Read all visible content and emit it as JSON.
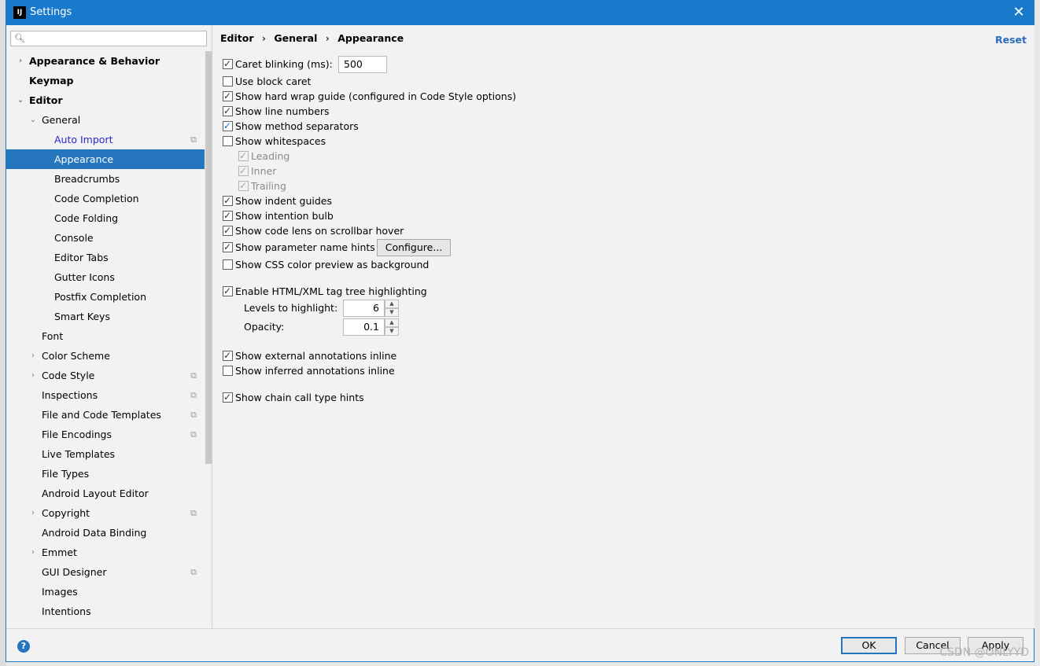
{
  "window": {
    "title": "Settings",
    "app_icon_text": "IJ",
    "close_glyph": "✕"
  },
  "search": {
    "value": "",
    "placeholder": ""
  },
  "sidebar": {
    "items": [
      {
        "label": "Appearance & Behavior",
        "bold": true,
        "arrow": "›",
        "level": 0,
        "copy": false
      },
      {
        "label": "Keymap",
        "bold": true,
        "arrow": "",
        "level": 0,
        "copy": false
      },
      {
        "label": "Editor",
        "bold": true,
        "arrow": "⌄",
        "level": 0,
        "copy": false
      },
      {
        "label": "General",
        "bold": false,
        "arrow": "⌄",
        "level": 1,
        "copy": false
      },
      {
        "label": "Auto Import",
        "bold": false,
        "arrow": "",
        "level": 2,
        "copy": true,
        "link": true
      },
      {
        "label": "Appearance",
        "bold": false,
        "arrow": "",
        "level": 2,
        "copy": false,
        "selected": true
      },
      {
        "label": "Breadcrumbs",
        "bold": false,
        "arrow": "",
        "level": 2,
        "copy": false
      },
      {
        "label": "Code Completion",
        "bold": false,
        "arrow": "",
        "level": 2,
        "copy": false
      },
      {
        "label": "Code Folding",
        "bold": false,
        "arrow": "",
        "level": 2,
        "copy": false
      },
      {
        "label": "Console",
        "bold": false,
        "arrow": "",
        "level": 2,
        "copy": false
      },
      {
        "label": "Editor Tabs",
        "bold": false,
        "arrow": "",
        "level": 2,
        "copy": false
      },
      {
        "label": "Gutter Icons",
        "bold": false,
        "arrow": "",
        "level": 2,
        "copy": false
      },
      {
        "label": "Postfix Completion",
        "bold": false,
        "arrow": "",
        "level": 2,
        "copy": false
      },
      {
        "label": "Smart Keys",
        "bold": false,
        "arrow": "",
        "level": 2,
        "copy": false
      },
      {
        "label": "Font",
        "bold": false,
        "arrow": "",
        "level": 1,
        "copy": false
      },
      {
        "label": "Color Scheme",
        "bold": false,
        "arrow": "›",
        "level": 1,
        "copy": false
      },
      {
        "label": "Code Style",
        "bold": false,
        "arrow": "›",
        "level": 1,
        "copy": true
      },
      {
        "label": "Inspections",
        "bold": false,
        "arrow": "",
        "level": 1,
        "copy": true
      },
      {
        "label": "File and Code Templates",
        "bold": false,
        "arrow": "",
        "level": 1,
        "copy": true
      },
      {
        "label": "File Encodings",
        "bold": false,
        "arrow": "",
        "level": 1,
        "copy": true
      },
      {
        "label": "Live Templates",
        "bold": false,
        "arrow": "",
        "level": 1,
        "copy": false
      },
      {
        "label": "File Types",
        "bold": false,
        "arrow": "",
        "level": 1,
        "copy": false
      },
      {
        "label": "Android Layout Editor",
        "bold": false,
        "arrow": "",
        "level": 1,
        "copy": false
      },
      {
        "label": "Copyright",
        "bold": false,
        "arrow": "›",
        "level": 1,
        "copy": true
      },
      {
        "label": "Android Data Binding",
        "bold": false,
        "arrow": "",
        "level": 1,
        "copy": false
      },
      {
        "label": "Emmet",
        "bold": false,
        "arrow": "›",
        "level": 1,
        "copy": false
      },
      {
        "label": "GUI Designer",
        "bold": false,
        "arrow": "",
        "level": 1,
        "copy": true
      },
      {
        "label": "Images",
        "bold": false,
        "arrow": "",
        "level": 1,
        "copy": false
      },
      {
        "label": "Intentions",
        "bold": false,
        "arrow": "",
        "level": 1,
        "copy": false
      }
    ]
  },
  "breadcrumb": {
    "items": [
      "Editor",
      "General",
      "Appearance"
    ],
    "separator": "›"
  },
  "reset_label": "Reset",
  "options": {
    "caret_blinking": {
      "label": "Caret blinking (ms):",
      "checked": true,
      "value": "500"
    },
    "block_caret": {
      "label": "Use block caret",
      "checked": false
    },
    "hard_wrap": {
      "label": "Show hard wrap guide (configured in Code Style options)",
      "checked": true
    },
    "line_numbers": {
      "label": "Show line numbers",
      "checked": true
    },
    "method_separators": {
      "label": "Show method separators",
      "checked": true
    },
    "whitespaces": {
      "label": "Show whitespaces",
      "checked": false
    },
    "leading": {
      "label": "Leading",
      "checked": true
    },
    "inner": {
      "label": "Inner",
      "checked": true
    },
    "trailing": {
      "label": "Trailing",
      "checked": true
    },
    "indent_guides": {
      "label": "Show indent guides",
      "checked": true
    },
    "intention_bulb": {
      "label": "Show intention bulb",
      "checked": true
    },
    "code_lens": {
      "label": "Show code lens on scrollbar hover",
      "checked": true
    },
    "param_hints": {
      "label": "Show parameter name hints",
      "checked": true,
      "button": "Configure..."
    },
    "css_color": {
      "label": "Show CSS color preview as background",
      "checked": false
    },
    "tag_tree": {
      "label": "Enable HTML/XML tag tree highlighting",
      "checked": true
    },
    "levels": {
      "label": "Levels to highlight:",
      "value": "6"
    },
    "opacity": {
      "label": "Opacity:",
      "value": "0.1"
    },
    "ext_annotations": {
      "label": "Show external annotations inline",
      "checked": true
    },
    "inferred_annotations": {
      "label": "Show inferred annotations inline",
      "checked": false
    },
    "chain_hints": {
      "label": "Show chain call type hints",
      "checked": true
    }
  },
  "footer": {
    "help": "?",
    "ok": "OK",
    "cancel": "Cancel",
    "apply": "Apply",
    "watermark": "CSDN @ONLYYD"
  },
  "colors": {
    "accent": "#1979ca",
    "selection": "#2675bf",
    "link": "#2a6cc0"
  },
  "icons": {
    "search": "search-icon",
    "close": "close-icon",
    "copy": "copy-icon",
    "help": "help-icon"
  }
}
